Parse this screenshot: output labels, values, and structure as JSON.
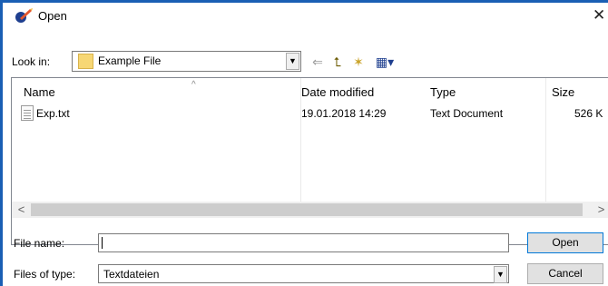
{
  "window": {
    "title": "Open",
    "close_glyph": "✕"
  },
  "toolbar": {
    "look_in_label_prefix": "Look in:",
    "look_in_value": "Example File",
    "back_glyph": "⇐",
    "up_glyph": "⮤",
    "new_folder_glyph": "✶",
    "view_glyph": "▦▾"
  },
  "list": {
    "columns": [
      "Name",
      "Date modified",
      "Type",
      "Size"
    ],
    "sort_glyph": "^",
    "rows": [
      {
        "name": "Exp.txt",
        "date": "19.01.2018 14:29",
        "type": "Text Document",
        "size": "526 K"
      }
    ],
    "scroll_left": "<",
    "scroll_right": ">"
  },
  "form": {
    "file_name_label": "File name:",
    "file_name_value": "",
    "files_of_type_label": "Files of type:",
    "files_of_type_value": "Textdateien",
    "open_button": "Open",
    "cancel_button": "Cancel"
  },
  "icons": [
    "app-pen-icon",
    "folder-icon",
    "back-arrow-icon",
    "up-one-level-icon",
    "new-folder-icon",
    "view-menu-icon",
    "text-file-icon",
    "close-icon"
  ]
}
